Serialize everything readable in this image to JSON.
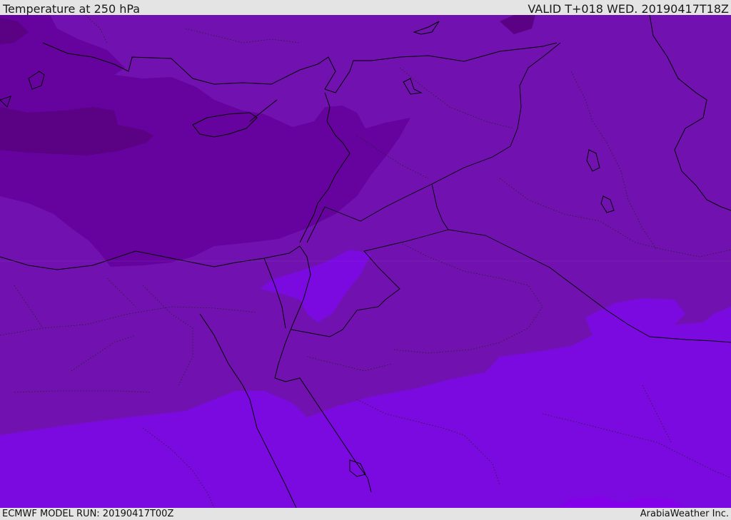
{
  "header": {
    "title": "Temperature at 250 hPa",
    "valid": "VALID T+018 WED. 20190417T18Z"
  },
  "footer": {
    "model_run": "ECMWF MODEL RUN: 20190417T00Z",
    "credit": "ArabiaWeather Inc."
  },
  "colors": {
    "band_base": "#7112b0",
    "band_dark": "#66039e",
    "band_darkest": "#5a0184",
    "band_light": "#7b0ae0",
    "band_lighter": "#8400e8",
    "coastline": "#000000",
    "border": "#000000",
    "frame": "#e4e4e4"
  }
}
